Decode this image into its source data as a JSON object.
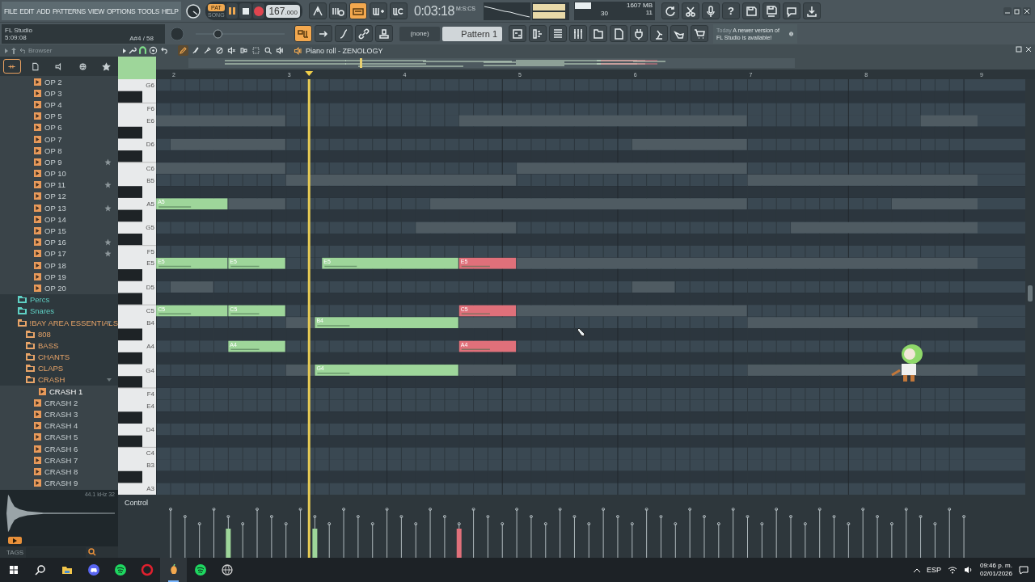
{
  "menu": [
    "FILE",
    "EDIT",
    "ADD",
    "PATTERNS",
    "VIEW",
    "OPTIONS",
    "TOOLS",
    "HELP"
  ],
  "hint_panel": {
    "title": "FL Studio",
    "time": "5:09:08",
    "note": "A#4 / 58"
  },
  "transport": {
    "modes": [
      {
        "label": "PAT",
        "selected": true
      },
      {
        "label": "SONG",
        "selected": false
      }
    ],
    "tempo": "167",
    "tempo_fraction": ".000"
  },
  "time": {
    "value": "0:03:18",
    "unit": "M:S:CS"
  },
  "master_pitch": {
    "level": 0.25
  },
  "cpu": {
    "cpu": "30",
    "memory": "1607 MB",
    "polyphony": "11"
  },
  "pattern": {
    "arrangement": "(none)",
    "name": "Pattern 1"
  },
  "news": {
    "date": "Today",
    "message": "A newer version of FL Studio is available!"
  },
  "toolbar": {
    "row1_left": [
      {
        "kind": "metronome",
        "on": false
      },
      {
        "kind": "wait",
        "on": false
      },
      {
        "kind": "typing",
        "on": true
      },
      {
        "kind": "stepplus",
        "on": false
      },
      {
        "kind": "loop",
        "on": false
      }
    ],
    "row1_right": [
      {
        "kind": "history",
        "on": false
      },
      {
        "kind": "scissors",
        "on": false
      },
      {
        "kind": "mic",
        "on": false
      },
      {
        "kind": "help",
        "label": "?",
        "on": false
      },
      {
        "kind": "save",
        "on": false
      },
      {
        "kind": "saveas",
        "on": false
      },
      {
        "kind": "chat",
        "on": false
      },
      {
        "kind": "download",
        "on": false
      }
    ],
    "row2_left": [
      {
        "kind": "steprec",
        "on": true
      },
      {
        "kind": "arrow",
        "on": false
      },
      {
        "kind": "curve",
        "on": false
      },
      {
        "kind": "link",
        "on": false
      },
      {
        "kind": "stamp",
        "on": false
      }
    ],
    "row2_right": [
      {
        "kind": "playlist",
        "on": false
      },
      {
        "kind": "pianoroll",
        "on": false
      },
      {
        "kind": "channels",
        "on": false
      },
      {
        "kind": "mixer",
        "on": false
      },
      {
        "kind": "browser",
        "on": false
      },
      {
        "kind": "file",
        "on": false
      },
      {
        "kind": "plug",
        "on": false
      },
      {
        "kind": "lamp",
        "on": false
      },
      {
        "kind": "hand",
        "on": false
      },
      {
        "kind": "cart",
        "on": false
      }
    ]
  },
  "browser": {
    "title": "Browser",
    "tabs": [
      {
        "kind": "all",
        "selected": true
      },
      {
        "kind": "files",
        "selected": false
      },
      {
        "kind": "plugins",
        "selected": false
      },
      {
        "kind": "online",
        "selected": false
      },
      {
        "kind": "favorites",
        "selected": false
      }
    ],
    "tree": [
      {
        "kind": "sample",
        "label": "OP 2",
        "starred": false,
        "selected": false
      },
      {
        "kind": "sample",
        "label": "OP 3",
        "starred": false,
        "selected": false
      },
      {
        "kind": "sample",
        "label": "OP 4",
        "starred": false,
        "selected": false
      },
      {
        "kind": "sample",
        "label": "OP 5",
        "starred": false,
        "selected": false
      },
      {
        "kind": "sample",
        "label": "OP 6",
        "starred": false,
        "selected": false
      },
      {
        "kind": "sample",
        "label": "OP 7",
        "starred": false,
        "selected": false
      },
      {
        "kind": "sample",
        "label": "OP 8",
        "starred": false,
        "selected": false
      },
      {
        "kind": "sample",
        "label": "OP 9",
        "starred": true,
        "selected": false
      },
      {
        "kind": "sample",
        "label": "OP 10",
        "starred": false,
        "selected": false
      },
      {
        "kind": "sample",
        "label": "OP 11",
        "starred": true,
        "selected": false
      },
      {
        "kind": "sample",
        "label": "OP 12",
        "starred": false,
        "selected": false
      },
      {
        "kind": "sample",
        "label": "OP 13",
        "starred": true,
        "selected": false
      },
      {
        "kind": "sample",
        "label": "OP 14",
        "starred": false,
        "selected": false
      },
      {
        "kind": "sample",
        "label": "OP 15",
        "starred": false,
        "selected": false
      },
      {
        "kind": "sample",
        "label": "OP 16",
        "starred": true,
        "selected": false
      },
      {
        "kind": "sample",
        "label": "OP 17",
        "starred": true,
        "selected": false
      },
      {
        "kind": "sample",
        "label": "OP 18",
        "starred": false,
        "selected": false
      },
      {
        "kind": "sample",
        "label": "OP 19",
        "starred": false,
        "selected": false
      },
      {
        "kind": "sample",
        "label": "OP 20",
        "starred": false,
        "selected": false
      },
      {
        "kind": "folder",
        "label": "Percs",
        "color": "#5fd0c4",
        "expanded": false
      },
      {
        "kind": "folder",
        "label": "Snares",
        "color": "#5fd0c4",
        "expanded": false
      },
      {
        "kind": "folder",
        "label": "!BAY AREA ESSENTIALS",
        "color": "#e8a468",
        "expanded": true,
        "children": [
          {
            "kind": "folder",
            "label": "808",
            "color": "#e8a468",
            "expanded": false
          },
          {
            "kind": "folder",
            "label": "BASS",
            "color": "#e8a468",
            "expanded": false
          },
          {
            "kind": "folder",
            "label": "CHANTS",
            "color": "#e8a468",
            "expanded": false
          },
          {
            "kind": "folder",
            "label": "CLAPS",
            "color": "#e8a468",
            "expanded": false
          },
          {
            "kind": "folder",
            "label": "CRASH",
            "color": "#e8a468",
            "expanded": true,
            "children": [
              {
                "kind": "sample",
                "label": "CRASH 1",
                "starred": false,
                "selected": true
              },
              {
                "kind": "sample",
                "label": "CRASH 2",
                "starred": false,
                "selected": false
              },
              {
                "kind": "sample",
                "label": "CRASH 3",
                "starred": false,
                "selected": false
              },
              {
                "kind": "sample",
                "label": "CRASH 4",
                "starred": false,
                "selected": false
              },
              {
                "kind": "sample",
                "label": "CRASH 5",
                "starred": false,
                "selected": false
              },
              {
                "kind": "sample",
                "label": "CRASH 6",
                "starred": false,
                "selected": false
              },
              {
                "kind": "sample",
                "label": "CRASH 7",
                "starred": false,
                "selected": false
              },
              {
                "kind": "sample",
                "label": "CRASH 8",
                "starred": false,
                "selected": false
              },
              {
                "kind": "sample",
                "label": "CRASH 9",
                "starred": false,
                "selected": false
              }
            ]
          }
        ]
      }
    ],
    "sample_info": "44.1 kHz 32",
    "tags_label": "TAGS"
  },
  "piano_roll": {
    "title": "Piano roll - ZENOLOGY",
    "magnet_on": true,
    "tools": [
      {
        "kind": "pencil",
        "selected": true
      },
      {
        "kind": "brush",
        "selected": false
      },
      {
        "kind": "brush2",
        "selected": false
      },
      {
        "kind": "delete",
        "selected": false
      },
      {
        "kind": "mute",
        "selected": false
      },
      {
        "kind": "slip",
        "selected": false
      },
      {
        "kind": "select",
        "selected": false
      },
      {
        "kind": "zoom",
        "selected": false
      },
      {
        "kind": "playback",
        "selected": false
      }
    ],
    "ruler": [
      "2",
      "3",
      "4",
      "5",
      "6",
      "7",
      "8",
      "9"
    ],
    "keys": [
      "G6",
      "F6",
      "E6",
      "D6",
      "C6",
      "B5",
      "A5",
      "G5",
      "F5",
      "E5",
      "D5",
      "C5",
      "B4",
      "A4",
      "G4",
      "F4",
      "E4",
      "D4",
      "C4",
      "B3",
      "A3"
    ],
    "notes": [
      {
        "kind": "ghost"
      },
      {
        "kind": "ghost"
      },
      {
        "kind": "ghost"
      },
      {
        "kind": "ghost"
      },
      {
        "kind": "ghost"
      },
      {
        "kind": "ghost"
      },
      {
        "kind": "ghost"
      },
      {
        "kind": "ghost"
      },
      {
        "kind": "ghost"
      },
      {
        "kind": "ghost"
      },
      {
        "kind": "ghost"
      },
      {
        "kind": "ghost"
      },
      {
        "kind": "ghost"
      },
      {
        "kind": "ghost"
      },
      {
        "kind": "ghost"
      },
      {
        "kind": "ghost"
      },
      {
        "kind": "ghost"
      },
      {
        "kind": "ghost"
      },
      {
        "kind": "ghost"
      },
      {
        "kind": "ghost"
      },
      {
        "kind": "ghost"
      },
      {
        "kind": "ghost"
      },
      {
        "kind": "ghost"
      },
      {
        "kind": "ghost"
      },
      {
        "kind": "note",
        "label": "A5",
        "color": "#9ed69a"
      },
      {
        "kind": "note",
        "label": "E5",
        "color": "#9ed69a"
      },
      {
        "kind": "note",
        "label": "E5",
        "color": "#9ed69a"
      },
      {
        "kind": "note",
        "label": "E5",
        "color": "#9ed69a"
      },
      {
        "kind": "note",
        "label": "E5",
        "color": "#e0707a"
      },
      {
        "kind": "note",
        "label": "C5",
        "color": "#9ed69a"
      },
      {
        "kind": "note",
        "label": "C5",
        "color": "#9ed69a"
      },
      {
        "kind": "note",
        "label": "C5",
        "color": "#e0707a"
      },
      {
        "kind": "note",
        "label": "B4",
        "color": "#9ed69a"
      },
      {
        "kind": "note",
        "label": "A4",
        "color": "#9ed69a"
      },
      {
        "kind": "note",
        "label": "A4",
        "color": "#e0707a"
      },
      {
        "kind": "note",
        "label": "G4",
        "color": "#9ed69a"
      }
    ],
    "control_label": "Control"
  },
  "taskbar": {
    "apps": [
      {
        "kind": "start",
        "selected": false
      },
      {
        "kind": "search",
        "selected": false
      },
      {
        "kind": "files",
        "selected": false
      },
      {
        "kind": "chat",
        "selected": false
      },
      {
        "kind": "music",
        "selected": false
      },
      {
        "kind": "browser",
        "selected": false
      },
      {
        "kind": "daw",
        "selected": true
      },
      {
        "kind": "music",
        "selected": false
      },
      {
        "kind": "globe",
        "selected": false
      }
    ],
    "language": "ESP",
    "time": "09:46 p. m.",
    "date": "02/01/2026"
  }
}
